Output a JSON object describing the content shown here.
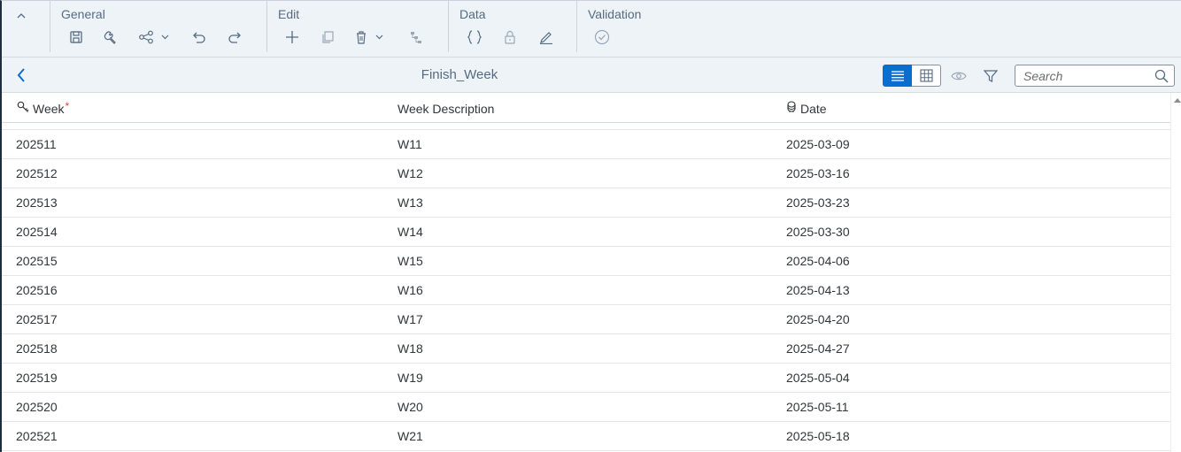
{
  "toolbar": {
    "groups": [
      {
        "label": "General"
      },
      {
        "label": "Edit"
      },
      {
        "label": "Data"
      },
      {
        "label": "Validation"
      }
    ],
    "icons": {
      "collapse": "chevron-up-icon",
      "save": "save-icon",
      "settings": "wrench-icon",
      "share": "share-icon",
      "undo": "undo-icon",
      "redo": "redo-icon",
      "add": "add-icon",
      "copy": "copy-icon",
      "delete": "delete-icon",
      "hierarchy": "hierarchy-icon",
      "formula": "curly-braces-icon",
      "lock": "lock-icon",
      "edit": "pen-icon",
      "validate": "check-circle-icon"
    }
  },
  "titlebar": {
    "title": "Finish_Week",
    "search_placeholder": "Search"
  },
  "table": {
    "columns": [
      {
        "label": "Week",
        "required": "*",
        "icon": "key-icon"
      },
      {
        "label": "Week Description"
      },
      {
        "label": "Date",
        "icon": "stamp-icon"
      }
    ],
    "rows": [
      {
        "week": "202511",
        "desc": "W11",
        "date": "2025-03-09"
      },
      {
        "week": "202512",
        "desc": "W12",
        "date": "2025-03-16"
      },
      {
        "week": "202513",
        "desc": "W13",
        "date": "2025-03-23"
      },
      {
        "week": "202514",
        "desc": "W14",
        "date": "2025-03-30"
      },
      {
        "week": "202515",
        "desc": "W15",
        "date": "2025-04-06"
      },
      {
        "week": "202516",
        "desc": "W16",
        "date": "2025-04-13"
      },
      {
        "week": "202517",
        "desc": "W17",
        "date": "2025-04-20"
      },
      {
        "week": "202518",
        "desc": "W18",
        "date": "2025-04-27"
      },
      {
        "week": "202519",
        "desc": "W19",
        "date": "2025-05-04"
      },
      {
        "week": "202520",
        "desc": "W20",
        "date": "2025-05-11"
      },
      {
        "week": "202521",
        "desc": "W21",
        "date": "2025-05-18"
      }
    ]
  },
  "colors": {
    "accent": "#0a6ed1",
    "toolbar_bg": "#eef3f8",
    "icon": "#556b82",
    "required": "#e9413e"
  }
}
